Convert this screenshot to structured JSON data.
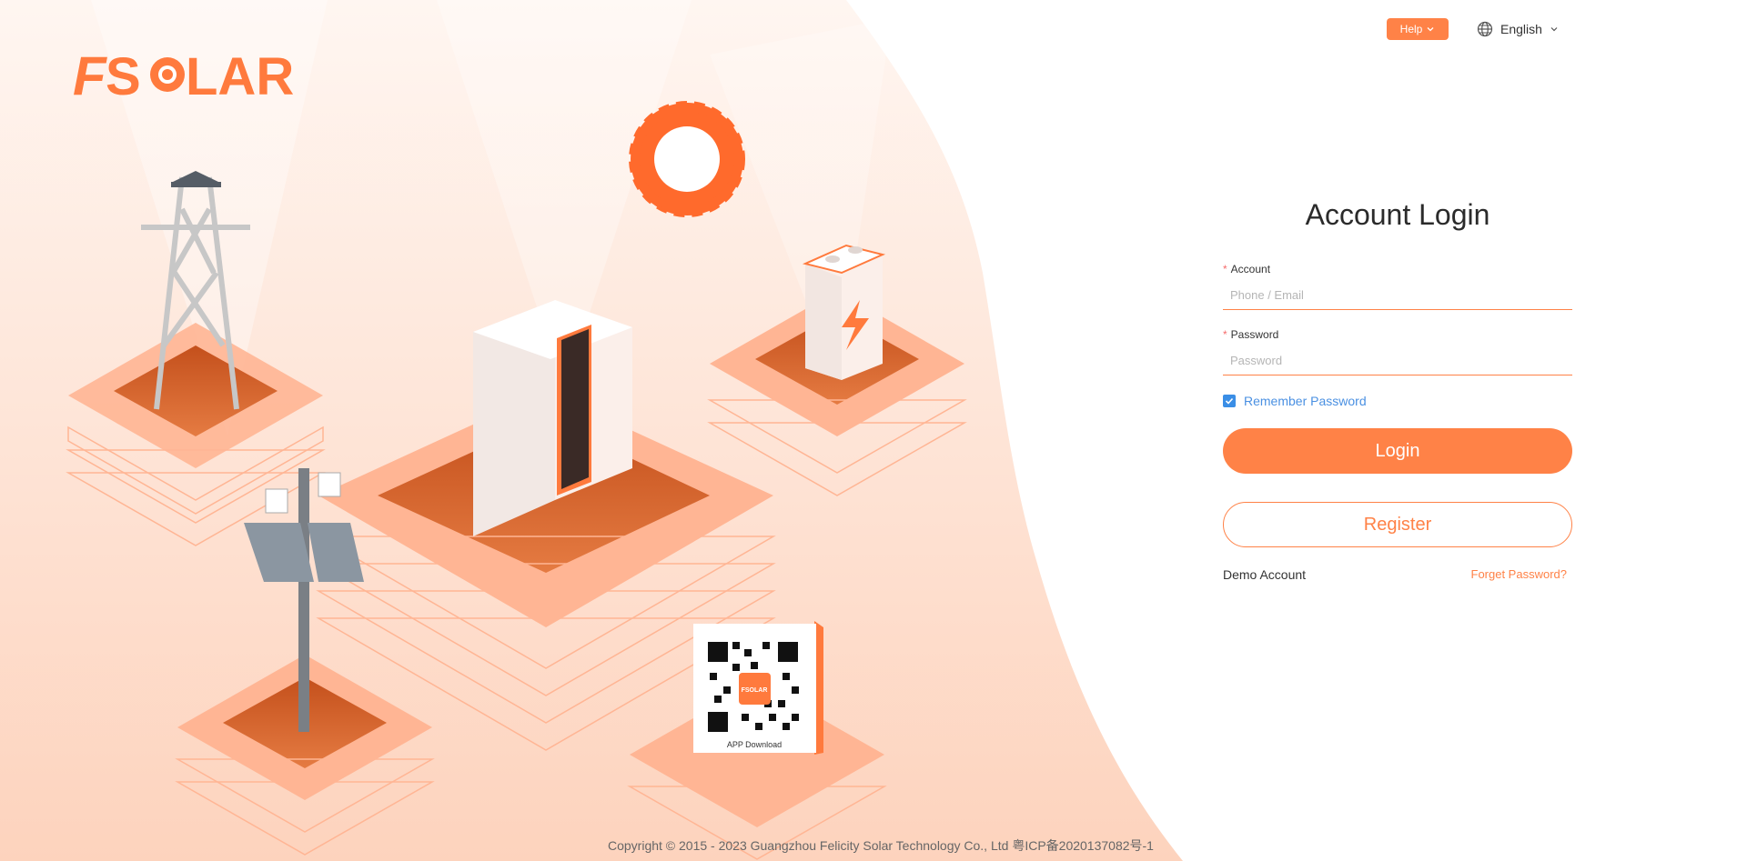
{
  "brand": {
    "logo_text": "FSOLAR",
    "accent": "#ff8247"
  },
  "topbar": {
    "help_label": "Help",
    "language_label": "English",
    "globe_icon": "globe-icon",
    "chevron_icon": "chevron-down-icon"
  },
  "qr": {
    "caption": "APP Download",
    "badge_text": "FSOLAR"
  },
  "login": {
    "title": "Account Login",
    "account_label": "Account",
    "account_placeholder": "Phone / Email",
    "account_value": "",
    "password_label": "Password",
    "password_placeholder": "Password",
    "password_value": "",
    "remember_label": "Remember Password",
    "remember_checked": true,
    "login_button": "Login",
    "register_button": "Register",
    "demo_link": "Demo Account",
    "forget_link": "Forget Password?"
  },
  "footer": {
    "copyright": "Copyright © 2015 - 2023 Guangzhou Felicity Solar Technology Co., Ltd 粤ICP备2020137082号-1"
  }
}
